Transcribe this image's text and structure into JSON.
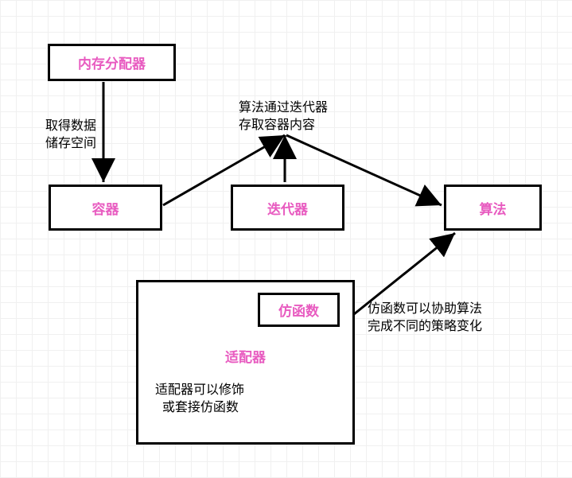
{
  "boxes": {
    "allocator": "内存分配器",
    "container": "容器",
    "iterator": "迭代器",
    "algorithm": "算法",
    "functor": "仿函数",
    "adapter": "适配器"
  },
  "labels": {
    "allocator_to_container": "取得数据\n储存空间",
    "iterator_top": "算法通过迭代器\n存取容器内容",
    "functor_to_algorithm": "仿函数可以协助算法\n完成不同的策略变化",
    "adapter_note": "适配器可以修饰\n  或套接仿函数"
  }
}
